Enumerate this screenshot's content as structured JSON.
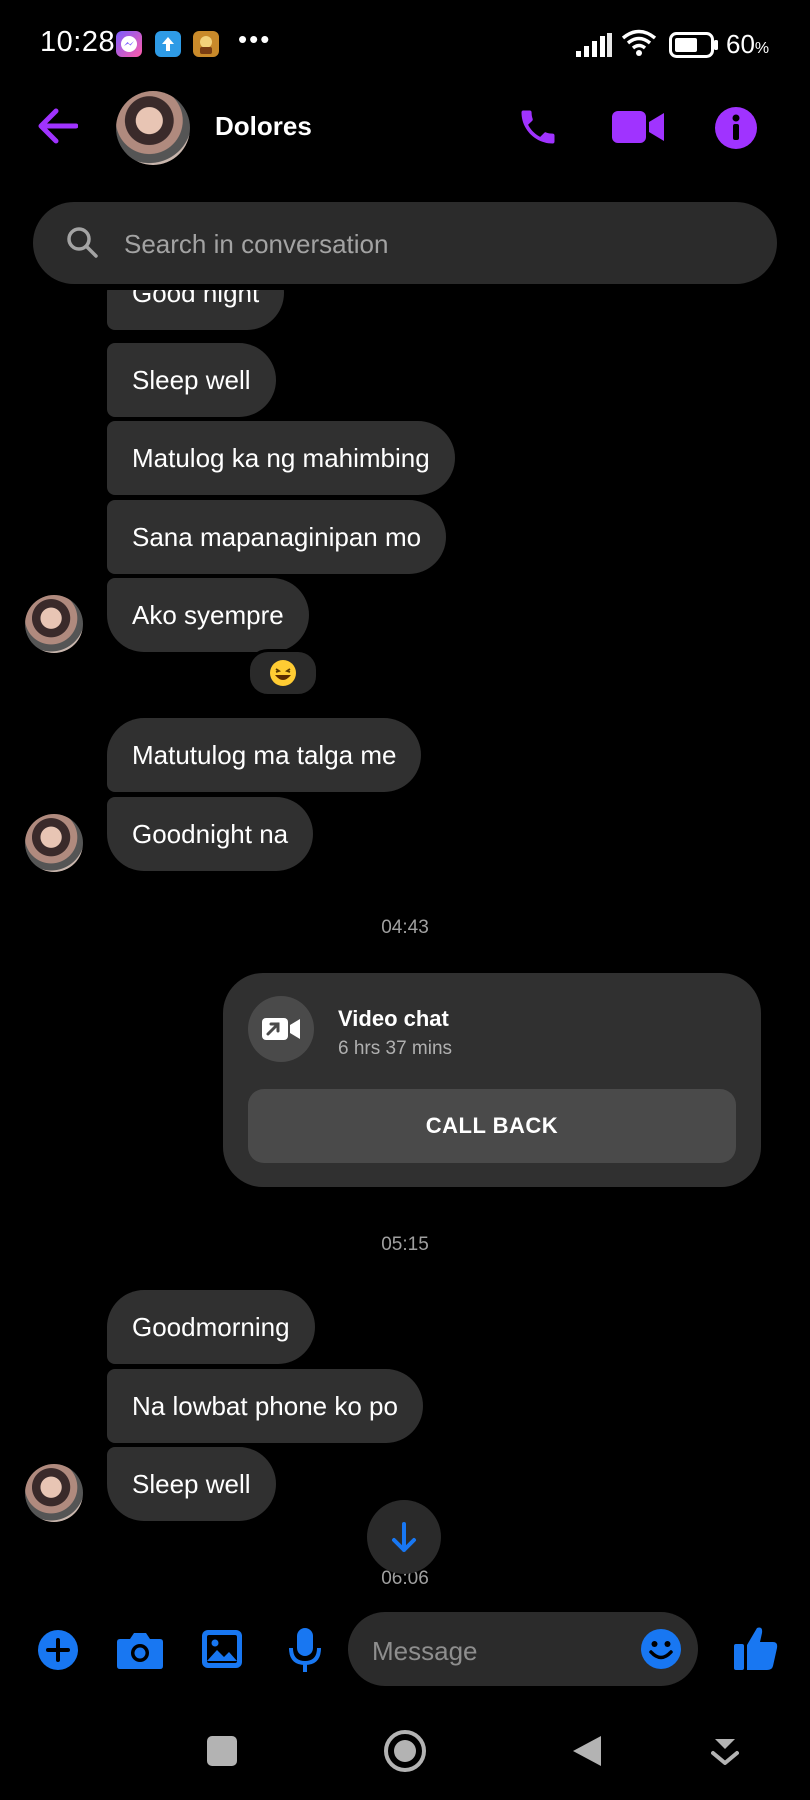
{
  "status_bar": {
    "time": "10:28",
    "more": "•••",
    "battery": "60",
    "battery_unit": "%"
  },
  "header": {
    "contact_name": "Dolores",
    "accent_color": "#a033ff"
  },
  "search": {
    "placeholder": "Search in conversation"
  },
  "messages": [
    {
      "text": "Good night",
      "group": 1
    },
    {
      "text": "Sleep well",
      "group": 1
    },
    {
      "text": "Matulog ka ng mahimbing",
      "group": 1
    },
    {
      "text": "Sana mapanaginipan mo",
      "group": 1
    },
    {
      "text": "Ako syempre",
      "group": 1,
      "reaction": "laughing-emoji"
    },
    {
      "text": "Matutulog ma talga me",
      "group": 2
    },
    {
      "text": "Goodnight na",
      "group": 2
    },
    {
      "text": "Goodmorning",
      "group": 3
    },
    {
      "text": "Na lowbat phone ko po",
      "group": 3
    },
    {
      "text": "Sleep well",
      "group": 3
    }
  ],
  "timestamps": [
    "04:43",
    "05:15",
    "06:06"
  ],
  "video_chat": {
    "title": "Video chat",
    "duration": "6 hrs 37 mins",
    "button_label": "CALL BACK"
  },
  "composer": {
    "placeholder": "Message",
    "icon_color": "#1877f2"
  },
  "colors": {
    "bubble": "#303030",
    "background": "#000000"
  }
}
